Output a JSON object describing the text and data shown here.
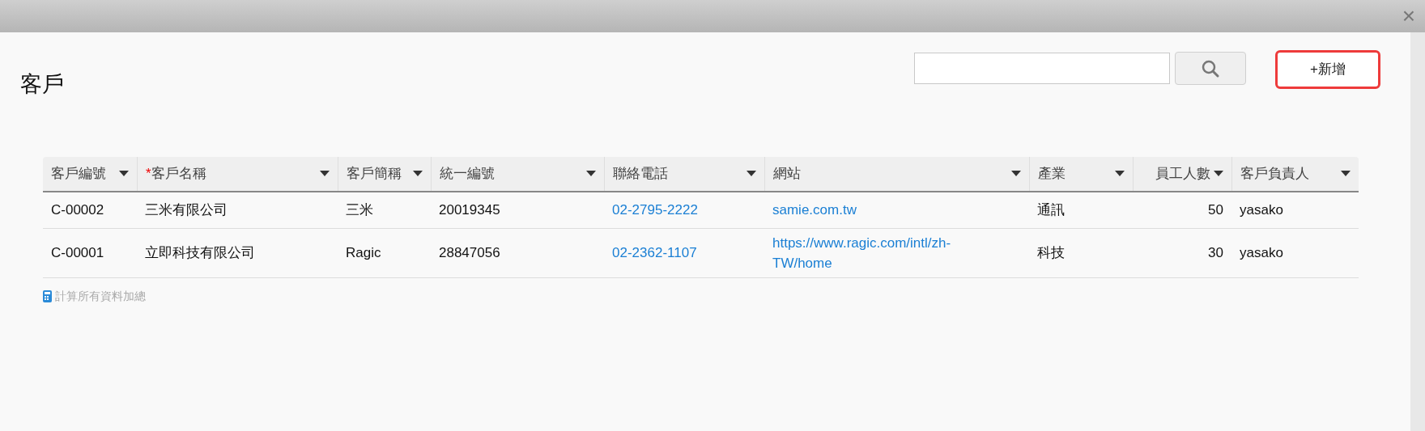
{
  "window": {
    "close": "×"
  },
  "title": "客戶",
  "new_button": "+新增",
  "table": {
    "columns": [
      {
        "label": "客戶編號",
        "kind": "text"
      },
      {
        "label": "客戶名稱",
        "required_mark": "*",
        "kind": "text"
      },
      {
        "label": "客戶簡稱",
        "kind": "text"
      },
      {
        "label": "統一編號",
        "kind": "text"
      },
      {
        "label": "聯絡電話",
        "kind": "link"
      },
      {
        "label": "網站",
        "kind": "link"
      },
      {
        "label": "產業",
        "kind": "text"
      },
      {
        "label": "員工人數",
        "kind": "number"
      },
      {
        "label": "客戶負責人",
        "kind": "text"
      }
    ],
    "rows": [
      [
        "C-00002",
        "三米有限公司",
        "三米",
        "20019345",
        "02-2795-2222",
        "samie.com.tw",
        "通訊",
        "50",
        "yasako"
      ],
      [
        "C-00001",
        "立即科技有限公司",
        "Ragic",
        "28847056",
        "02-2362-1107",
        "https://www.ragic.com/intl/zh-TW/home",
        "科技",
        "30",
        "yasako"
      ]
    ]
  },
  "footer_link": "計算所有資料加總"
}
